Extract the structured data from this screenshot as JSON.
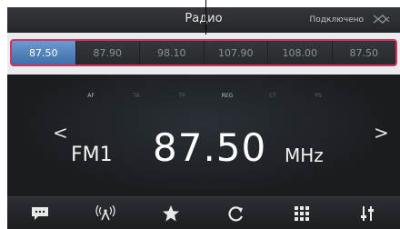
{
  "header": {
    "title": "Радио",
    "status": "Подключено",
    "bt_icon": "bluetooth-icon"
  },
  "presets": [
    {
      "freq": "87.50",
      "active": true
    },
    {
      "freq": "87.90",
      "active": false
    },
    {
      "freq": "98.10",
      "active": false
    },
    {
      "freq": "107.90",
      "active": false
    },
    {
      "freq": "108.00",
      "active": false
    },
    {
      "freq": "87.50",
      "active": false
    }
  ],
  "indicators": [
    {
      "label": "AF",
      "on": true
    },
    {
      "label": "TA",
      "on": false
    },
    {
      "label": "TP",
      "on": false
    },
    {
      "label": "REG",
      "on": true
    },
    {
      "label": "CT",
      "on": false
    },
    {
      "label": "PS",
      "on": false
    }
  ],
  "tuner": {
    "band": "FM1",
    "frequency": "87.50",
    "unit": "MHz",
    "prev_symbol": "<",
    "next_symbol": ">"
  },
  "toolbar": [
    {
      "icon": "message-icon"
    },
    {
      "icon": "broadcast-icon"
    },
    {
      "icon": "star-icon"
    },
    {
      "icon": "refresh-icon"
    },
    {
      "icon": "grid-icon"
    },
    {
      "icon": "equalizer-icon"
    }
  ],
  "colors": {
    "accent_frame": "#d5325e",
    "active_preset": "#5585bf",
    "background": "#1d1f22"
  }
}
